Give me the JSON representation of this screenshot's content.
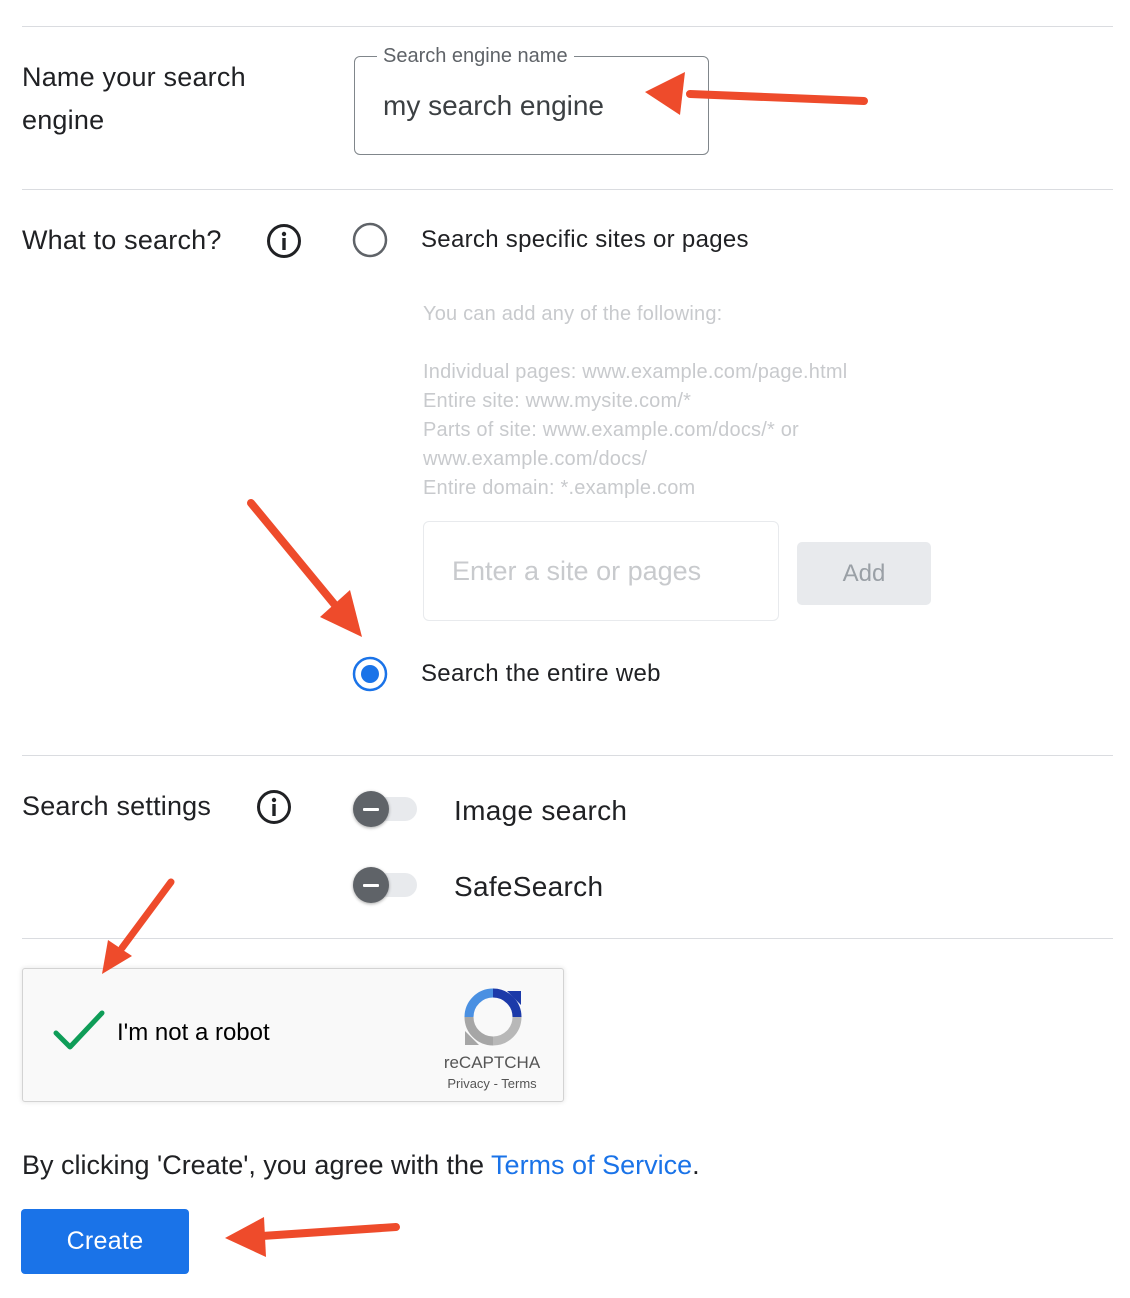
{
  "name_section": {
    "title": "Name your search engine",
    "field_label": "Search engine name",
    "field_value": "my search engine"
  },
  "what_section": {
    "title": "What to search?",
    "info_icon": "info-icon",
    "option_specific": "Search specific sites or pages",
    "hint_intro": "You can add any of the following:",
    "hint_pages": "Individual pages: www.example.com/page.html",
    "hint_site": "Entire site: www.mysite.com/*",
    "hint_parts_1": "Parts of site: www.example.com/docs/* or",
    "hint_parts_2": "www.example.com/docs/",
    "hint_domain": "Entire domain: *.example.com",
    "site_placeholder": "Enter a site or pages",
    "add_label": "Add",
    "option_entire_web": "Search the entire web",
    "selected_option": "Search the entire web"
  },
  "settings_section": {
    "title": "Search settings",
    "info_icon": "info-icon",
    "image_search_label": "Image search",
    "image_search_enabled": false,
    "safesearch_label": "SafeSearch",
    "safesearch_enabled": false
  },
  "captcha": {
    "label": "I'm not a robot",
    "checked": true,
    "brand": "reCAPTCHA",
    "privacy": "Privacy",
    "separator": "-",
    "terms": "Terms"
  },
  "footer": {
    "agree_prefix": "By clicking 'Create', you agree with the ",
    "tos_link": "Terms of Service",
    "agree_suffix": ".",
    "create_label": "Create"
  },
  "colors": {
    "accent": "#1a73e8",
    "annotation_arrow": "#ee4b2b",
    "check": "#0f9d58"
  }
}
